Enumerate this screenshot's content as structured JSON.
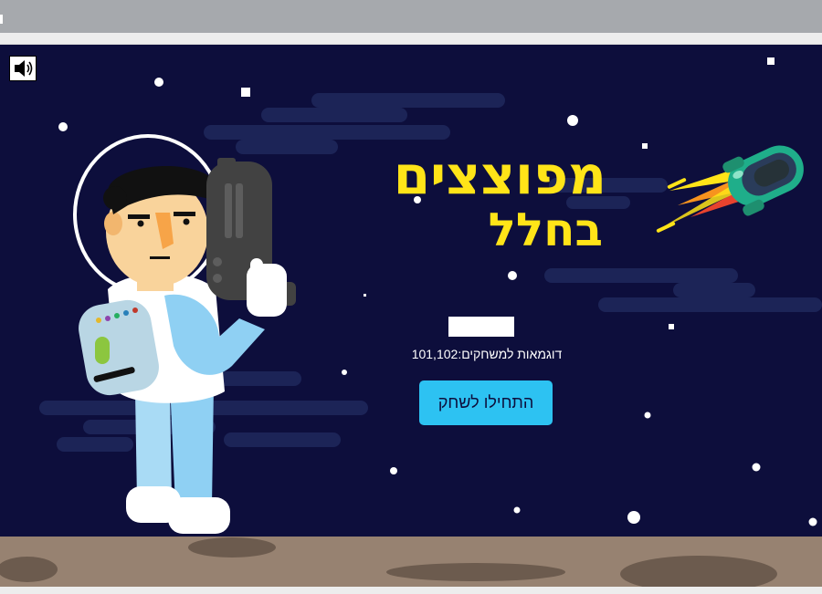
{
  "game": {
    "title_line1": "מפוצצים",
    "title_line2": "בחלל",
    "name_input_value": "",
    "samples_label": "דוגמאות למשחקים:",
    "samples_count": "101,102",
    "samples_text": "דוגמאות למשחקים:101,102",
    "start_button_label": "התחילו לשחק"
  },
  "icons": {
    "sound": "speaker-icon",
    "character": "astronaut",
    "vehicle": "rocket"
  },
  "colors": {
    "sky": "#0d0e3c",
    "cloud": "#1c2457",
    "title": "#ffe418",
    "button": "#2dc2f2",
    "ground": "#978271",
    "frame": "#a6a9ad"
  }
}
